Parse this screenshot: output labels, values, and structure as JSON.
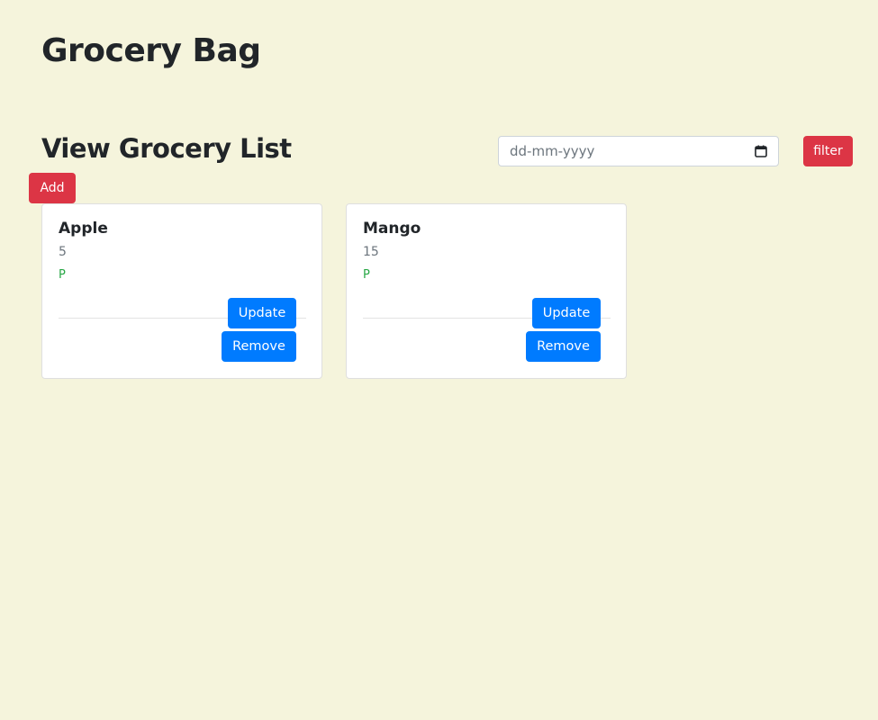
{
  "header": {
    "title": "Grocery Bag"
  },
  "section": {
    "title": "View Grocery List"
  },
  "filter": {
    "date_placeholder": "dd-mm-yyyy",
    "button_label": "filter"
  },
  "add_button_label": "Add",
  "items": [
    {
      "name": "Apple",
      "quantity": "5",
      "status": "P",
      "update_label": "Update",
      "remove_label": "Remove"
    },
    {
      "name": "Mango",
      "quantity": "15",
      "status": "P",
      "update_label": "Update",
      "remove_label": "Remove"
    }
  ],
  "colors": {
    "background": "#f5f4dc",
    "danger": "#dc3545",
    "primary": "#007bff",
    "status_green": "#28a745"
  },
  "icons": {
    "date_picker": "calendar-icon"
  }
}
